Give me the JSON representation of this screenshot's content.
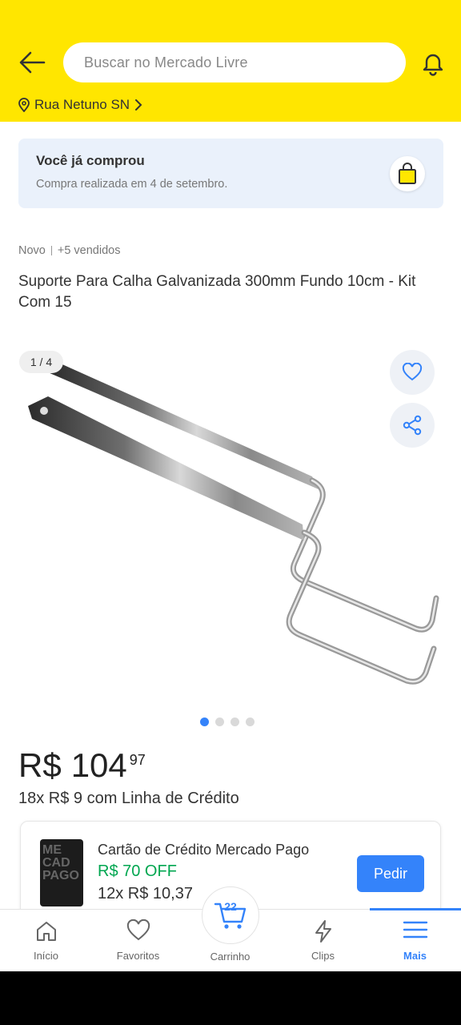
{
  "header": {
    "search_placeholder": "Buscar no Mercado Livre",
    "location": "Rua Netuno SN",
    "icons": [
      "back-arrow-icon",
      "bell-icon",
      "location-pin-icon",
      "chevron-right-icon"
    ],
    "background_color": "#ffe600"
  },
  "purchase_banner": {
    "title": "Você já comprou",
    "subtitle": "Compra realizada em 4 de setembro.",
    "icon": "shopping-bag-icon"
  },
  "product": {
    "condition": "Novo",
    "sold": "+5 vendidos",
    "title": "Suporte Para Calha Galvanizada 300mm Fundo 10cm - Kit Com 15",
    "gallery": {
      "counter": "1 / 4",
      "total_images": 4,
      "active_image": 1,
      "icons": [
        "heart-icon",
        "share-icon"
      ]
    },
    "price": {
      "currency": "R$",
      "integer": "104",
      "cents": "97"
    },
    "installments": "18x R$ 9 com Linha de Crédito"
  },
  "credit_offer": {
    "title": "Cartão de Crédito Mercado Pago",
    "discount": "R$ 70 OFF",
    "installments": "12x R$ 10,37",
    "button": "Pedir",
    "card_text": "ME CAD PAGO"
  },
  "bottom_nav": {
    "items": [
      {
        "label": "Início",
        "icon": "home-icon"
      },
      {
        "label": "Favoritos",
        "icon": "heart-icon"
      },
      {
        "label": "Carrinho",
        "icon": "cart-icon",
        "badge": "22"
      },
      {
        "label": "Clips",
        "icon": "lightning-icon"
      },
      {
        "label": "Mais",
        "icon": "menu-icon",
        "active": true
      }
    ]
  },
  "colors": {
    "accent": "#3483fa",
    "success": "#00a650",
    "header": "#ffe600"
  }
}
